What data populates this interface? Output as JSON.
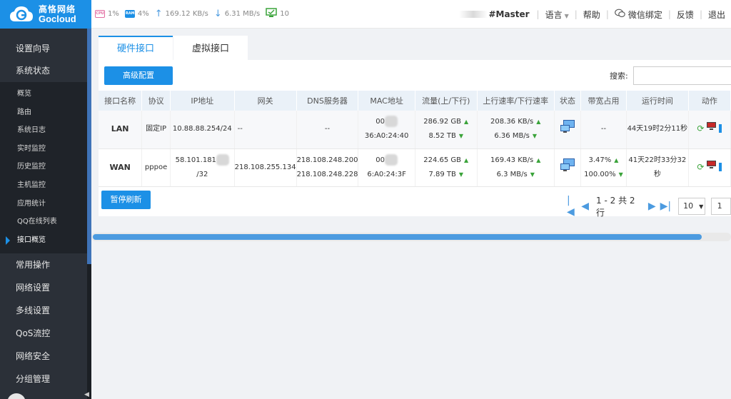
{
  "brand": {
    "cn": "高恪网络",
    "en": "Gocloud"
  },
  "topbar": {
    "cpu_label": "CPU",
    "cpu": "1%",
    "ram_label": "RAM",
    "ram": "4%",
    "upload": "169.12 KB/s",
    "download": "6.31 MB/s",
    "devices": "10",
    "user": "#Master",
    "language": "语言",
    "help": "帮助",
    "wechat": "微信绑定",
    "feedback": "反馈",
    "logout": "退出"
  },
  "sidebar": {
    "top_items": [
      {
        "label": "设置向导"
      },
      {
        "label": "系统状态"
      }
    ],
    "sub_items": [
      {
        "label": "概览"
      },
      {
        "label": "路由"
      },
      {
        "label": "系统日志"
      },
      {
        "label": "实时监控"
      },
      {
        "label": "历史监控"
      },
      {
        "label": "主机监控"
      },
      {
        "label": "应用统计"
      },
      {
        "label": "QQ在线列表"
      },
      {
        "label": "接口概览",
        "active": true
      }
    ],
    "lower_items": [
      {
        "label": "常用操作"
      },
      {
        "label": "网络设置"
      },
      {
        "label": "多线设置"
      },
      {
        "label": "QoS流控"
      },
      {
        "label": "网络安全"
      },
      {
        "label": "分组管理"
      }
    ]
  },
  "tabs": [
    {
      "label": "硬件接口",
      "active": true
    },
    {
      "label": "虚拟接口"
    }
  ],
  "toolbar": {
    "advanced": "高级配置",
    "search_label": "搜索:"
  },
  "table": {
    "headers": [
      "接口名称",
      "协议",
      "IP地址",
      "网关",
      "DNS服务器",
      "MAC地址",
      "流量(上/下行)",
      "上行速率/下行速率",
      "状态",
      "带宽占用",
      "运行时间",
      "动作"
    ],
    "rows": [
      {
        "name": "LAN",
        "protocol": "固定IP",
        "ip": "10.88.88.254/24",
        "gateway": "--",
        "dns1": "--",
        "dns2": "",
        "mac_prefix": "00",
        "mac_suffix": "36:A0:24:40",
        "traffic_up": "286.92 GB",
        "traffic_down": "8.52 TB",
        "rate_up": "208.36 KB/s",
        "rate_down": "6.36 MB/s",
        "bw1": "--",
        "bw2": "",
        "uptime": "44天19时2分11秒"
      },
      {
        "name": "WAN",
        "protocol": "pppoe",
        "ip_prefix": "58.101.181",
        "ip_suffix": "/32",
        "gateway": "218.108.255.134",
        "dns1": "218.108.248.200",
        "dns2": "218.108.248.228",
        "mac_prefix": "00",
        "mac_suffix": "6:A0:24:3F",
        "traffic_up": "224.65 GB",
        "traffic_down": "7.89 TB",
        "rate_up": "169.43 KB/s",
        "rate_down": "6.3 MB/s",
        "bw1": "3.47%",
        "bw2": "100.00%",
        "uptime": "41天22时33分32秒"
      }
    ]
  },
  "footer": {
    "pause": "暂停刷新",
    "page_info": "1 - 2 共 2 行",
    "page_size": "10",
    "page_num": "1"
  },
  "colors": {
    "accent": "#1c90e6",
    "sidebar_bg": "#2b3038",
    "header_row": "#eaf1f8"
  }
}
